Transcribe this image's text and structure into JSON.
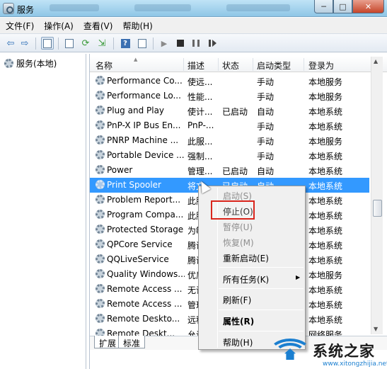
{
  "window": {
    "title": "服务",
    "caption": {
      "minimize": "─",
      "maximize": "□",
      "close": "✕"
    }
  },
  "menu": [
    "文件(F)",
    "操作(A)",
    "查看(V)",
    "帮助(H)"
  ],
  "tree": {
    "root": "服务(本地)"
  },
  "columns": [
    "名称",
    "描述",
    "状态",
    "启动类型",
    "登录为"
  ],
  "services": [
    {
      "name": "Performance Co...",
      "desc": "使远...",
      "state": "",
      "startup": "手动",
      "logon": "本地服务"
    },
    {
      "name": "Performance Lo...",
      "desc": "性能...",
      "state": "",
      "startup": "手动",
      "logon": "本地服务"
    },
    {
      "name": "Plug and Play",
      "desc": "使计...",
      "state": "已启动",
      "startup": "自动",
      "logon": "本地系统"
    },
    {
      "name": "PnP-X IP Bus En...",
      "desc": "PnP-...",
      "state": "",
      "startup": "手动",
      "logon": "本地系统"
    },
    {
      "name": "PNRP Machine ...",
      "desc": "此服...",
      "state": "",
      "startup": "手动",
      "logon": "本地服务"
    },
    {
      "name": "Portable Device ...",
      "desc": "强制...",
      "state": "",
      "startup": "手动",
      "logon": "本地系统"
    },
    {
      "name": "Power",
      "desc": "管理...",
      "state": "已启动",
      "startup": "自动",
      "logon": "本地系统"
    },
    {
      "name": "Print Spooler",
      "desc": "将文",
      "state": "已启动",
      "startup": "自动",
      "logon": "本地系统"
    },
    {
      "name": "Problem Report...",
      "desc": "此服",
      "state": "",
      "startup": "",
      "logon": "本地系统"
    },
    {
      "name": "Program Compa...",
      "desc": "此服",
      "state": "",
      "startup": "",
      "logon": "本地系统"
    },
    {
      "name": "Protected Storage",
      "desc": "为敏",
      "state": "",
      "startup": "",
      "logon": "本地系统"
    },
    {
      "name": "QPCore Service",
      "desc": "腾讯",
      "state": "",
      "startup": "",
      "logon": "本地系统"
    },
    {
      "name": "QQLiveService",
      "desc": "腾讯",
      "state": "",
      "startup": "",
      "logon": "本地系统"
    },
    {
      "name": "Quality Windows...",
      "desc": "优质",
      "state": "",
      "startup": "",
      "logon": "本地服务"
    },
    {
      "name": "Remote Access ...",
      "desc": "无论",
      "state": "",
      "startup": "",
      "logon": "本地系统"
    },
    {
      "name": "Remote Access ...",
      "desc": "管理",
      "state": "",
      "startup": "",
      "logon": "本地系统"
    },
    {
      "name": "Remote Deskto...",
      "desc": "远程",
      "state": "",
      "startup": "",
      "logon": "本地系统"
    },
    {
      "name": "Remote Deskt...",
      "desc": "允许",
      "state": "",
      "startup": "",
      "logon": "网络服务"
    }
  ],
  "selected_index": 7,
  "tabs": [
    "扩展",
    "标准"
  ],
  "context_menu": {
    "start": "启动(S)",
    "stop": "停止(O)",
    "pause": "暂停(U)",
    "resume": "恢复(M)",
    "restart": "重新启动(E)",
    "all_tasks": "所有任务(K)",
    "refresh": "刷新(F)",
    "properties": "属性(R)",
    "help": "帮助(H)",
    "submenu_arrow": "▶"
  },
  "watermark": {
    "text": "系统之家",
    "url": "www.xitongzhijia.net"
  },
  "colors": {
    "selection": "#3399ff",
    "highlight_box": "#d9251c"
  }
}
